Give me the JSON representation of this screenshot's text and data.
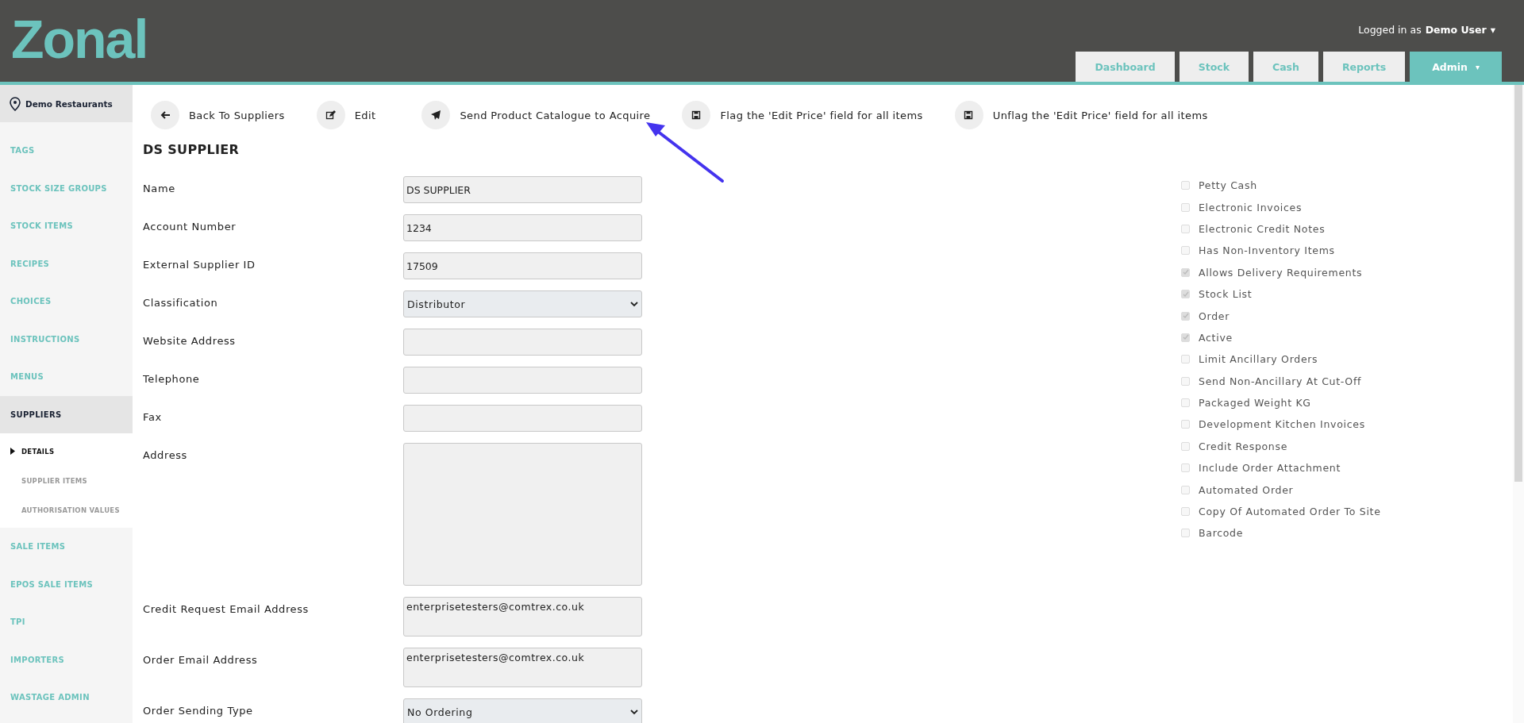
{
  "header": {
    "logo": "Zonal",
    "user_prefix": "Logged in as",
    "user_name": "Demo User",
    "user_caret": "▾",
    "tabs": [
      {
        "label": "Dashboard",
        "selected": false
      },
      {
        "label": "Stock",
        "selected": false
      },
      {
        "label": "Cash",
        "selected": false
      },
      {
        "label": "Reports",
        "selected": false
      },
      {
        "label": "Admin",
        "selected": true,
        "caret": "▾"
      }
    ]
  },
  "sidebar": {
    "location": "Demo Restaurants",
    "items": [
      {
        "label": "TAGS",
        "selected": false
      },
      {
        "label": "STOCK SIZE GROUPS",
        "selected": false
      },
      {
        "label": "STOCK ITEMS",
        "selected": false
      },
      {
        "label": "RECIPES",
        "selected": false
      },
      {
        "label": "CHOICES",
        "selected": false
      },
      {
        "label": "INSTRUCTIONS",
        "selected": false
      },
      {
        "label": "MENUS",
        "selected": false
      },
      {
        "label": "SUPPLIERS",
        "selected": true,
        "children": [
          {
            "label": "DETAILS",
            "selected": true
          },
          {
            "label": "SUPPLIER ITEMS",
            "selected": false
          },
          {
            "label": "AUTHORISATION VALUES",
            "selected": false
          }
        ]
      },
      {
        "label": "SALE ITEMS",
        "selected": false
      },
      {
        "label": "EPOS SALE ITEMS",
        "selected": false
      },
      {
        "label": "TPI",
        "selected": false
      },
      {
        "label": "IMPORTERS",
        "selected": false
      },
      {
        "label": "WASTAGE ADMIN",
        "selected": false
      }
    ]
  },
  "toolbar": [
    {
      "kind": "back",
      "label": "Back To Suppliers"
    },
    {
      "kind": "edit",
      "label": "Edit"
    },
    {
      "kind": "send",
      "label": "Send Product Catalogue to Acquire"
    },
    {
      "kind": "save",
      "label": "Flag the 'Edit Price' field for all items"
    },
    {
      "kind": "save",
      "label": "Unflag the 'Edit Price' field for all items"
    }
  ],
  "title": "DS SUPPLIER",
  "fields": [
    {
      "label": "Name",
      "kind": "text",
      "value": "DS SUPPLIER"
    },
    {
      "label": "Account Number",
      "kind": "text",
      "value": "1234"
    },
    {
      "label": "External Supplier ID",
      "kind": "text",
      "value": "17509"
    },
    {
      "label": "Classification",
      "kind": "select",
      "value": "Distributor"
    },
    {
      "label": "Website Address",
      "kind": "text"
    },
    {
      "label": "Telephone",
      "kind": "text"
    },
    {
      "label": "Fax",
      "kind": "text"
    },
    {
      "label": "Address",
      "kind": "textarea"
    },
    {
      "label": "Credit Request Email Address",
      "kind": "email",
      "value": "enterprisetesters@comtrex.co.uk"
    },
    {
      "label": "Order Email Address",
      "kind": "email",
      "value": "enterprisetesters@comtrex.co.uk"
    },
    {
      "label": "Order Sending Type",
      "kind": "select",
      "value": "No Ordering"
    }
  ],
  "options": [
    {
      "label": "Petty Cash",
      "checked": false
    },
    {
      "label": "Electronic Invoices",
      "checked": false
    },
    {
      "label": "Electronic Credit Notes",
      "checked": false
    },
    {
      "label": "Has Non-Inventory Items",
      "checked": false
    },
    {
      "label": "Allows Delivery Requirements",
      "checked": true
    },
    {
      "label": "Stock List",
      "checked": true
    },
    {
      "label": "Order",
      "checked": true
    },
    {
      "label": "Active",
      "checked": true
    },
    {
      "label": "Limit Ancillary Orders",
      "checked": false
    },
    {
      "label": "Send Non-Ancillary At Cut-Off",
      "checked": false
    },
    {
      "label": "Packaged Weight KG",
      "checked": false
    },
    {
      "label": "Development Kitchen Invoices",
      "checked": false
    },
    {
      "label": "Credit Response",
      "checked": false
    },
    {
      "label": "Include Order Attachment",
      "checked": false
    },
    {
      "label": "Automated Order",
      "checked": false
    },
    {
      "label": "Copy Of Automated Order To Site",
      "checked": false
    },
    {
      "label": "Barcode",
      "checked": false
    }
  ]
}
